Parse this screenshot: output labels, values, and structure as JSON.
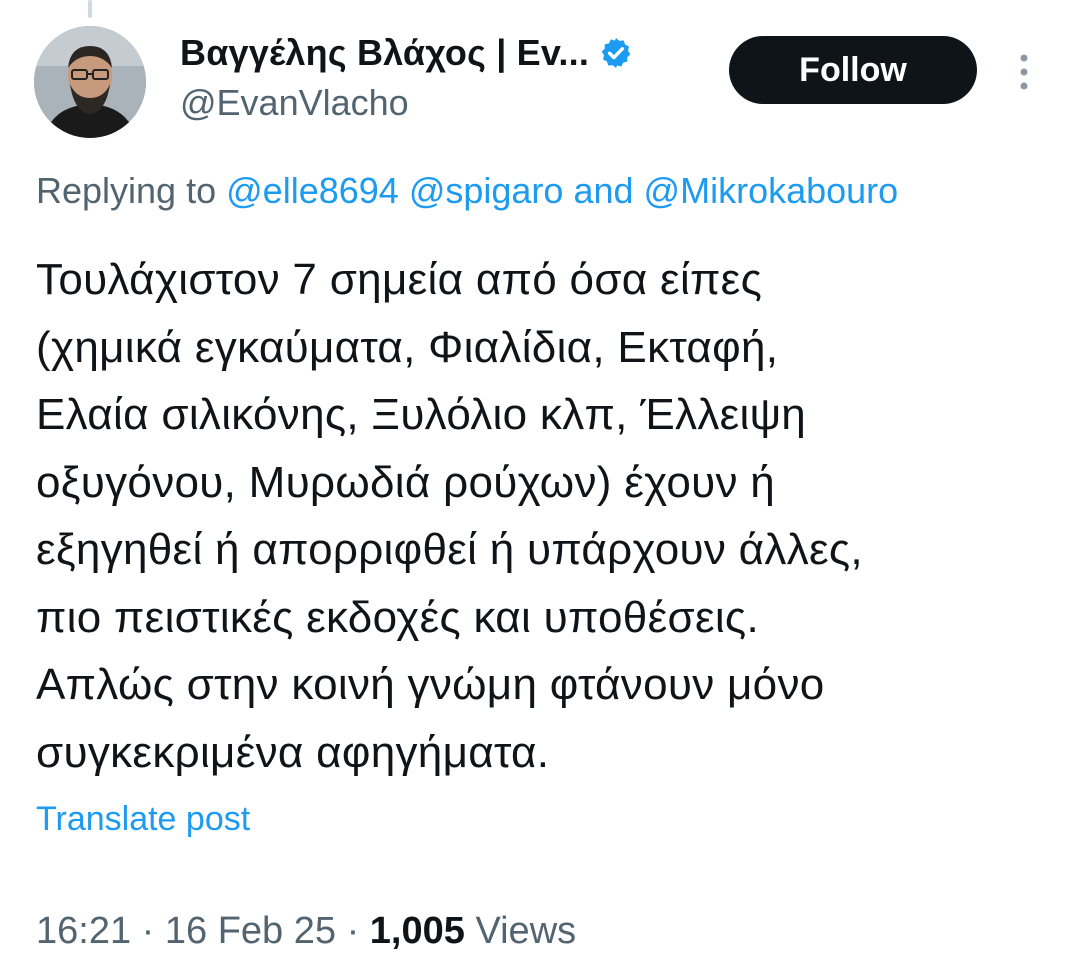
{
  "author": {
    "display_name": "Βαγγέλης Βλάχος | Ev...",
    "handle": "@EvanVlacho",
    "verified": true,
    "avatar_icon": "profile-photo"
  },
  "actions": {
    "follow_label": "Follow",
    "more_icon": "more-vertical-icon"
  },
  "reply": {
    "prefix": "Replying to",
    "mentions": [
      "@elle8694",
      "@spigaro",
      "@Mikrokabouro"
    ],
    "conjunction": "and"
  },
  "tweet": {
    "lines": [
      "Τουλάχιστον 7 σημεία από όσα είπες",
      "(χημικά εγκαύματα, Φιαλίδια, Εκταφή,",
      "Ελαία σιλικόνης, Ξυλόλιο κλπ, Έλλειψη",
      "οξυγόνου, Μυρωδιά ρούχων) έχουν ή",
      "εξηγηθεί ή απορριφθεί ή υπάρχουν άλλες,",
      "πιο πειστικές εκδοχές και υποθέσεις.",
      "Απλώς στην κοινή γνώμη φτάνουν μόνο",
      "συγκεκριμένα αφηγήματα."
    ],
    "translate_label": "Translate post"
  },
  "meta": {
    "time": "16:21",
    "date": "16 Feb 25",
    "separator": "·",
    "views_count": "1,005",
    "views_label": "Views"
  },
  "colors": {
    "accent": "#1d9bf0",
    "text": "#0f1419",
    "secondary": "#536471",
    "button_bg": "#0f1419"
  }
}
